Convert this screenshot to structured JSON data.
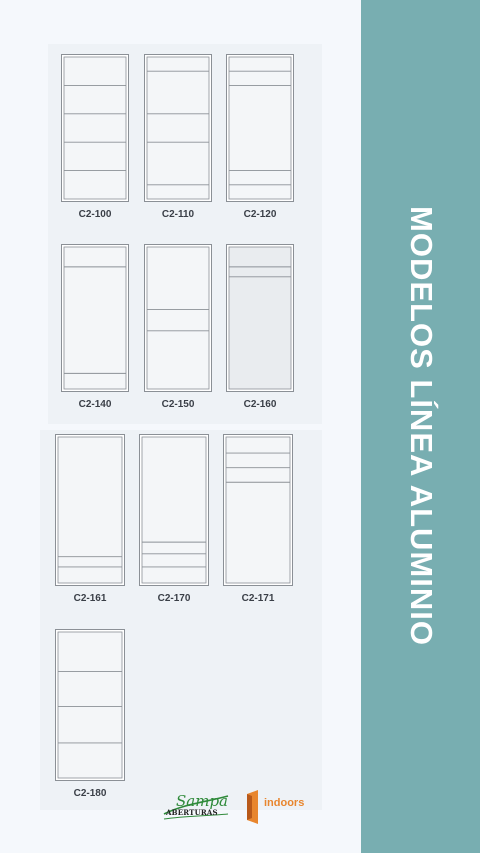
{
  "title": "MODELOS LÍNEA ALUMINIO",
  "models": [
    {
      "label": "C2-100",
      "rails": [
        0.2,
        0.4,
        0.6,
        0.8
      ],
      "glass": false
    },
    {
      "label": "C2-110",
      "rails": [
        0.1,
        0.4,
        0.6,
        0.9
      ],
      "glass": false
    },
    {
      "label": "C2-120",
      "rails": [
        0.1,
        0.2,
        0.8,
        0.9
      ],
      "glass": false
    },
    {
      "label": "C2-140",
      "rails": [
        0.14,
        0.89
      ],
      "glass": false
    },
    {
      "label": "C2-150",
      "rails": [
        0.44,
        0.59
      ],
      "glass": false
    },
    {
      "label": "C2-160",
      "rails": [
        0.14,
        0.21
      ],
      "glass": true
    },
    {
      "label": "C2-161",
      "rails": [
        0.82,
        0.89
      ],
      "glass": false
    },
    {
      "label": "C2-170",
      "rails": [
        0.72,
        0.8,
        0.89
      ],
      "glass": false
    },
    {
      "label": "C2-171",
      "rails": [
        0.11,
        0.21,
        0.31
      ],
      "glass": false
    },
    {
      "label": "C2-180",
      "rails": [
        0.27,
        0.51,
        0.76
      ],
      "glass": false
    }
  ],
  "logos": {
    "sampa": {
      "word": "Sampa",
      "subtitle": "ABERTURAS"
    },
    "indoors": {
      "word": "indoors"
    }
  },
  "colors": {
    "sidebar": "#78aeb1",
    "frame": "#8b9096",
    "door_fill": "#f4f6f8",
    "glass_fill": "#e9ecef",
    "label": "#3a3f47",
    "indoors_orange": "#e8862e",
    "sampa_green": "#2f8a3a"
  }
}
